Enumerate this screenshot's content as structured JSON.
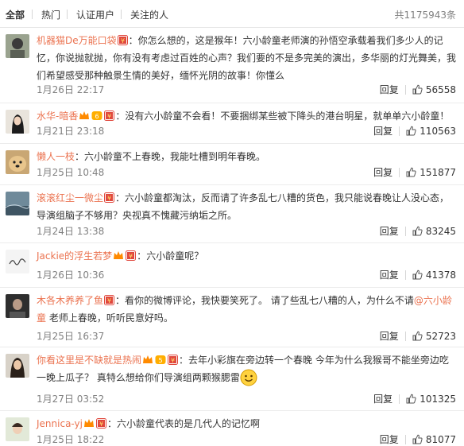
{
  "tabs": [
    {
      "label": "全部"
    },
    {
      "label": "热门"
    },
    {
      "label": "认证用户"
    },
    {
      "label": "关注的人"
    }
  ],
  "total_count": "共1175943条",
  "reply_label": "回复",
  "comments": [
    {
      "user": "机器猫De万能口袋",
      "prefix": "：",
      "text": "你怎么想的，这是猴年！六小龄童老师演的孙悟空承载着我们多少人的记忆，你说抛就抛，你有没有考虑过百姓的心声？我们要的不是多完美的演出，多华丽的灯光舞美，我们希望感受那种触景生情的美好，缅怀光阴的故事！你懂么",
      "date": "1月26日 22:17",
      "likes": "56558"
    },
    {
      "user": "水华-暗香",
      "prefix": "：",
      "text": "没有六小龄童不会看！不要捆绑某些被下降头的港台明星，就单单六小龄童！",
      "date": "1月21日 23:18",
      "likes": "110563"
    },
    {
      "user": "懒人一枝",
      "prefix": "：",
      "text": "六小龄童不上春晚，我能吐槽到明年春晚。",
      "date": "1月25日 10:48",
      "likes": "151877"
    },
    {
      "user": "滚滚红尘一微尘",
      "prefix": "：",
      "text": "六小龄童都淘汰，反而请了许多乱七八糟的货色，我只能说春晚让人没心态，导演组脑子不够用？央视真不愧藏污纳垢之所。",
      "date": "1月24日 13:38",
      "likes": "83245"
    },
    {
      "user": "Jackie的浮生若梦",
      "prefix": "：",
      "text": "六小龄童呢？",
      "date": "1月26日 10:36",
      "likes": "41378"
    },
    {
      "user": "木各木养养了鱼",
      "prefix": "：",
      "text_before": "看你的微博评论，我快要笑死了。 请了些乱七八糟的人，为什么不请",
      "mention": "@六小龄童",
      "text_after": " 老师上春晚，听听民意好吗。",
      "date": "1月25日 16:37",
      "likes": "52723"
    },
    {
      "user": "你看这里是不缺就是热闹",
      "prefix": "：",
      "text": "去年小彩旗在旁边转一个春晚 今年为什么我猴哥不能坐旁边吃一晚上瓜子？ 真特么想给你们导演组两颗猴腮雷",
      "date": "1月27日 03:52",
      "likes": "101325"
    },
    {
      "user": "Jennica-yj",
      "prefix": "：",
      "text": "六小龄童代表的是几代人的记忆啊",
      "date": "1月25日 18:22",
      "likes": "81077"
    }
  ],
  "icons": {
    "vip_badge": "vip-crown-icon",
    "member_badge": "red-envelope-icon",
    "like": "thumbs-up-icon",
    "emoji": "smile-emoji-icon"
  },
  "colors": {
    "username": "#eb7350",
    "meta": "#808080",
    "text": "#333333"
  }
}
